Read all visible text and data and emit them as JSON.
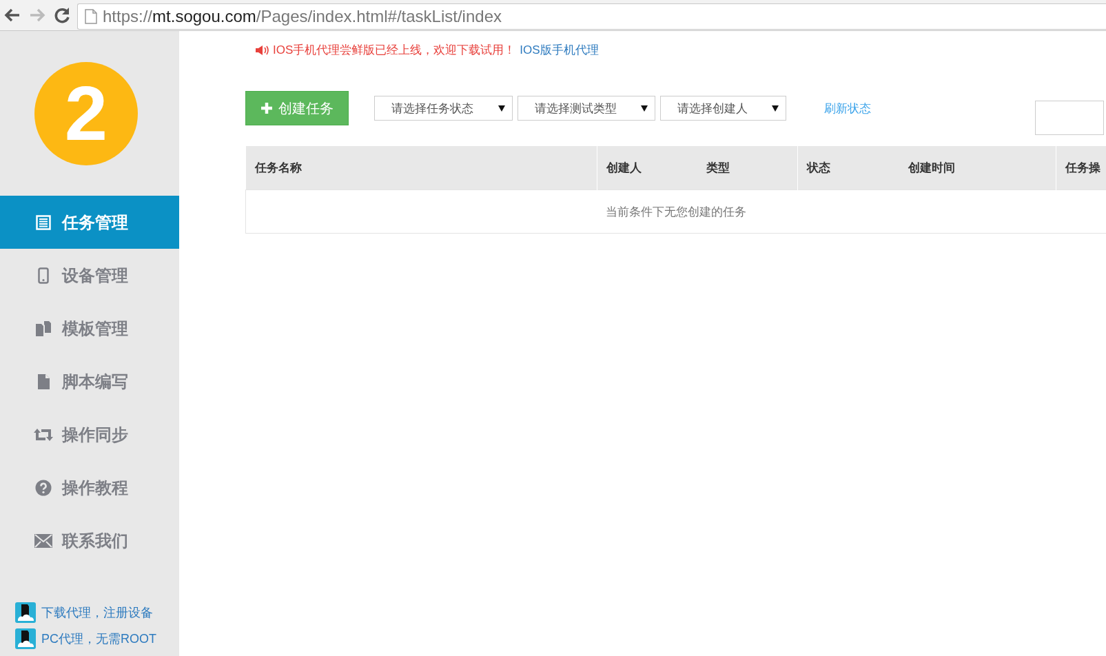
{
  "browser": {
    "url_scheme": "https://",
    "url_host": "mt.sogou.com",
    "url_path": "/Pages/index.html#/taskList/index"
  },
  "sidebar": {
    "logo": "2",
    "items": [
      {
        "label": "任务管理",
        "kind": "list",
        "selected": true
      },
      {
        "label": "设备管理",
        "kind": "phone",
        "selected": false
      },
      {
        "label": "模板管理",
        "kind": "copy",
        "selected": false
      },
      {
        "label": "脚本编写",
        "kind": "file",
        "selected": false
      },
      {
        "label": "操作同步",
        "kind": "sync",
        "selected": false
      },
      {
        "label": "操作教程",
        "kind": "question",
        "selected": false
      },
      {
        "label": "联系我们",
        "kind": "envelope",
        "selected": false
      }
    ],
    "footer_links": [
      "下载代理，注册设备",
      "PC代理，无需ROOT"
    ]
  },
  "notice": {
    "text": "IOS手机代理尝鲜版已经上线，欢迎下载试用！",
    "link": "IOS版手机代理"
  },
  "toolbar": {
    "create_button": "创建任务",
    "filters": [
      {
        "value": "请选择任务状态"
      },
      {
        "value": "请选择测试类型"
      },
      {
        "value": "请选择创建人"
      }
    ],
    "refresh_link": "刷新状态"
  },
  "table": {
    "columns": [
      "任务名称",
      "创建人",
      "类型",
      "状态",
      "创建时间",
      "任务操"
    ],
    "empty_message": "当前条件下无您创建的任务"
  }
}
